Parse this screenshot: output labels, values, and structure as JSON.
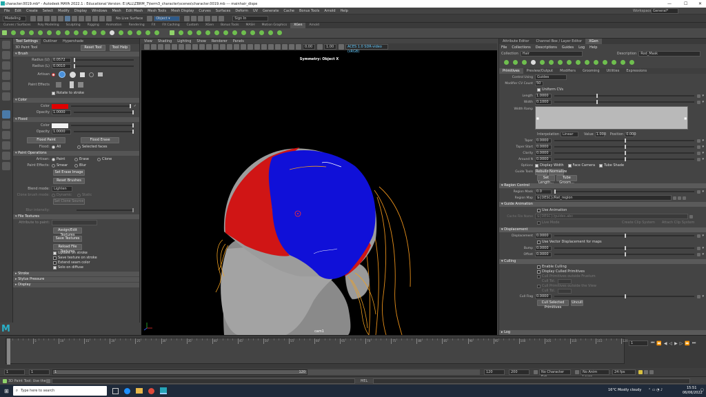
{
  "titlebar": {
    "title": "character.0019.mb* - Autodesk MAYA 2022.1 : Educational Version: E:\\ALL\\ZBRM_7\\term3_character\\scenes\\character.0019.mb  ---  mainhair_dispe"
  },
  "menus": [
    "File",
    "Edit",
    "Create",
    "Select",
    "Modify",
    "Display",
    "Windows",
    "Mesh",
    "Edit Mesh",
    "Mesh Tools",
    "Mesh Display",
    "Curves",
    "Surfaces",
    "Deform",
    "UV",
    "Generate",
    "Cache",
    "Bonus Tools",
    "Arnold",
    "Help"
  ],
  "workspace": {
    "label": "Workspace:",
    "value": "General*"
  },
  "statusline": {
    "mode": "Modeling",
    "live": "No Live Surface",
    "object": "Object ▾",
    "signin": "Sign In"
  },
  "shelf_tabs": [
    "Curves / Surfaces",
    "Poly Modeling",
    "Sculpting",
    "Rigging",
    "Animation",
    "Rendering",
    "FX",
    "FX Caching",
    "Custom",
    "XGen",
    "Bonus Tools",
    "MASH",
    "Motion Graphics",
    "XGen",
    "Arnold"
  ],
  "shelf_active": "XGen",
  "tool_settings": {
    "tabs": [
      "Tool Settings",
      "Outliner",
      "Hypershade"
    ],
    "title": "3D Paint Tool",
    "reset": "Reset Tool",
    "help": "Tool Help",
    "brush": {
      "header": "Brush",
      "radius_u_label": "Radius (U)",
      "radius_u": "0.0572",
      "radius_l_label": "Radius (L)",
      "radius_l": "0.0010",
      "artisan": "Artisan",
      "paint_effects": "Paint Effects",
      "rotate": "Rotate to stroke"
    },
    "color": {
      "header": "Color",
      "color_label": "Color",
      "opacity_label": "Opacity",
      "opacity": "1.0000"
    },
    "flood": {
      "header": "Flood",
      "color_label": "Color",
      "opacity_label": "Opacity",
      "opacity": "1.0000",
      "flood_paint": "Flood Paint",
      "flood_erase": "Flood Erase",
      "flood_label": "Flood:",
      "all": "All",
      "selected": "Selected faces"
    },
    "paint_ops": {
      "header": "Paint Operations",
      "artisan_label": "Artisan:",
      "paint": "Paint",
      "erase": "Erase",
      "clone": "Clone",
      "pe_label": "Paint Effects:",
      "smear": "Smear",
      "blur": "Blur",
      "set_erase": "Set Erase Image",
      "reset_brushes": "Reset Brushes",
      "blend_label": "Blend mode:",
      "blend": "Lighten",
      "clone_label": "Clone brush mode:",
      "dynamic": "Dynamic",
      "static": "Static",
      "set_clone": "Set Clone Source",
      "blur_label": "Blur intensity:"
    },
    "file_textures": {
      "header": "File Textures",
      "attr_label": "Attribute to paint:",
      "assign": "Assign/Edit Textures",
      "save": "Save Textures",
      "reload": "Reload File Textures",
      "update": "Update on stroke",
      "save_stroke": "Save texture on stroke",
      "extend": "Extend seam color",
      "diffuse": "Solo on diffuse"
    },
    "collapsed": [
      "Stroke",
      "Stylus Pressure",
      "Display"
    ]
  },
  "viewport": {
    "menus": [
      "View",
      "Shading",
      "Lighting",
      "Show",
      "Renderer",
      "Panels"
    ],
    "symmetry": "Symmetry: Object X",
    "camera": "cam1",
    "val1": "0.00",
    "val2": "1.00",
    "colorspace": "ACES 1.0 SDR-video (sRGB)"
  },
  "attr_editor": {
    "tabs": [
      "Attribute Editor",
      "Channel Box / Layer Editor",
      "XGen"
    ],
    "active": "XGen",
    "menus": [
      "File",
      "Collections",
      "Descriptions",
      "Guides",
      "Log",
      "Help"
    ],
    "collection_label": "Collection",
    "collection": "Hair",
    "description_label": "Description",
    "description": "Rod_Mask",
    "subtabs": [
      "Primitives",
      "Preview/Output",
      "Modifiers",
      "Grooming",
      "Utilities",
      "Expressions"
    ],
    "control_using_label": "Control Using",
    "control_using": "Guides",
    "mod_cv_label": "Modifier CV Count",
    "mod_cv": "50",
    "uniform": "Uniform CVs",
    "length_label": "Length",
    "length": "1.0000",
    "width_label": "Width",
    "width": "0.1000",
    "width_ramp": "Width Ramp",
    "interp_label": "Interpolation",
    "interp": "Linear",
    "value_label": "Value",
    "value": "1.000",
    "pos_label": "Position",
    "pos": "0.000",
    "taper_label": "Taper",
    "taper": "0.0000",
    "taper_start_label": "Taper Start",
    "taper_start": "0.0000",
    "clarity_label": "Clarity",
    "clarity": "0.0000",
    "around_label": "Around N",
    "around": "0.0000",
    "options_label": "Options",
    "display_width": "Display Width",
    "face_camera": "Face Camera",
    "tube_shade": "Tube Shade",
    "guide_tools": "Guide Tools",
    "rebuild": "Rebuild...",
    "normalize": "Normalize",
    "set_length": "Set Length...",
    "tube_groom": "Tube Groom...",
    "region": {
      "header": "Region Control",
      "mask_label": "Region Mask",
      "mask": "0.0",
      "map_label": "Region Map",
      "map": "${DESC}/Rat_region"
    },
    "guide_anim": {
      "header": "Guide Animation",
      "use": "Use Animation",
      "cache_label": "Cache File Name",
      "cache": "${DESC}/guides.abc",
      "live": "Live Mode",
      "create": "Create Clip System",
      "attach": "Attach Clip System"
    },
    "displacement": {
      "header": "Displacement",
      "disp_label": "Displacement",
      "disp": "0.0000",
      "vector": "Use Vector Displacement for maps",
      "bump_label": "Bump",
      "bump": "0.0000",
      "offset_label": "Offset",
      "offset": "0.0000"
    },
    "culling": {
      "header": "Culling",
      "enable": "Enable Culling",
      "display": "Display Culled Primitives",
      "cull_view": "Cull Primitives outside Frustum",
      "tol_label": "Cull Tol.",
      "cull_angle": "Cull Primitives outside the View",
      "cull_flag_label": "Cull Flag",
      "cull_flag": "0.0000",
      "cull_selected": "Cull Selected Primitives",
      "uncull": "Uncull"
    },
    "log": "Log"
  },
  "timeline": {
    "ticks": [
      "1",
      "5",
      "10",
      "15",
      "20",
      "25",
      "30",
      "35",
      "40",
      "45",
      "50",
      "55",
      "60",
      "65",
      "70",
      "75",
      "80",
      "85",
      "90",
      "95",
      "100",
      "105",
      "110",
      "115",
      "120"
    ],
    "current": "1"
  },
  "range": {
    "start": "1",
    "start2": "1",
    "end": "120",
    "end2": "120",
    "end3": "200",
    "char_set": "No Character Set",
    "anim_layer": "No Anim Layer",
    "fps": "24 fps"
  },
  "help_line": "3D Paint Tool: Use the help area",
  "mel": "MEL",
  "taskbar": {
    "search": "Type here to search",
    "weather": "16°C  Mostly cloudy",
    "time": "15:51",
    "date": "06/06/2022"
  }
}
